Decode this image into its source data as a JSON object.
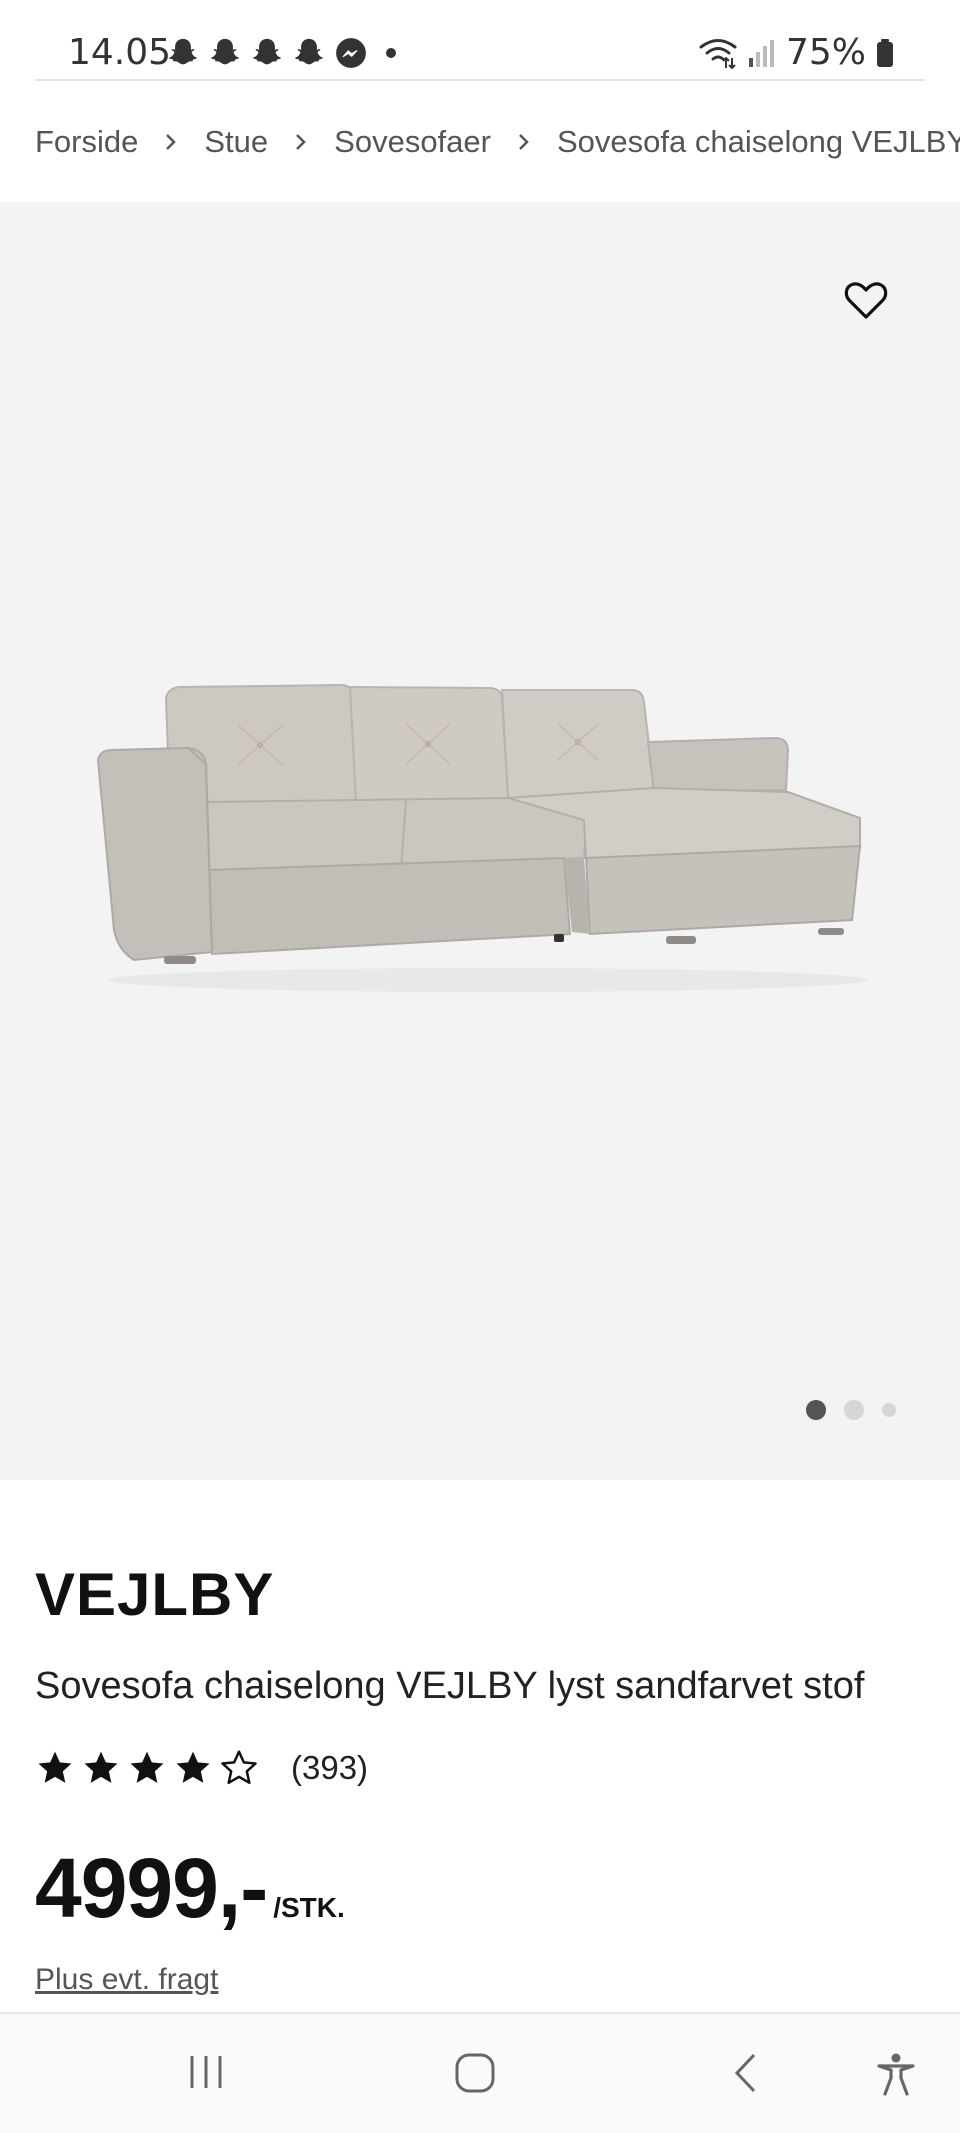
{
  "status_bar": {
    "time": "14.05",
    "battery_percent": "75%",
    "notification_icons": [
      "snapchat-icon",
      "snapchat-icon",
      "snapchat-icon",
      "snapchat-icon",
      "messenger-icon"
    ]
  },
  "breadcrumb": {
    "items": [
      "Forside",
      "Stue",
      "Sovesofaer",
      "Sovesofa chaiselong VEJLBY"
    ]
  },
  "gallery": {
    "image_count": 3,
    "active_index": 0
  },
  "product": {
    "brand": "VEJLBY",
    "name": "Sovesofa chaiselong VEJLBY lyst sandfarvet stof",
    "rating_stars": 4,
    "rating_max": 5,
    "review_count": "(393)",
    "price": "4999,-",
    "price_unit": "/STK.",
    "freight_link": "Plus evt. fragt"
  },
  "colors": {
    "hero_background": "#f3f3f3",
    "sofa_fabric": "#c9c4be",
    "text_primary": "#111111"
  }
}
